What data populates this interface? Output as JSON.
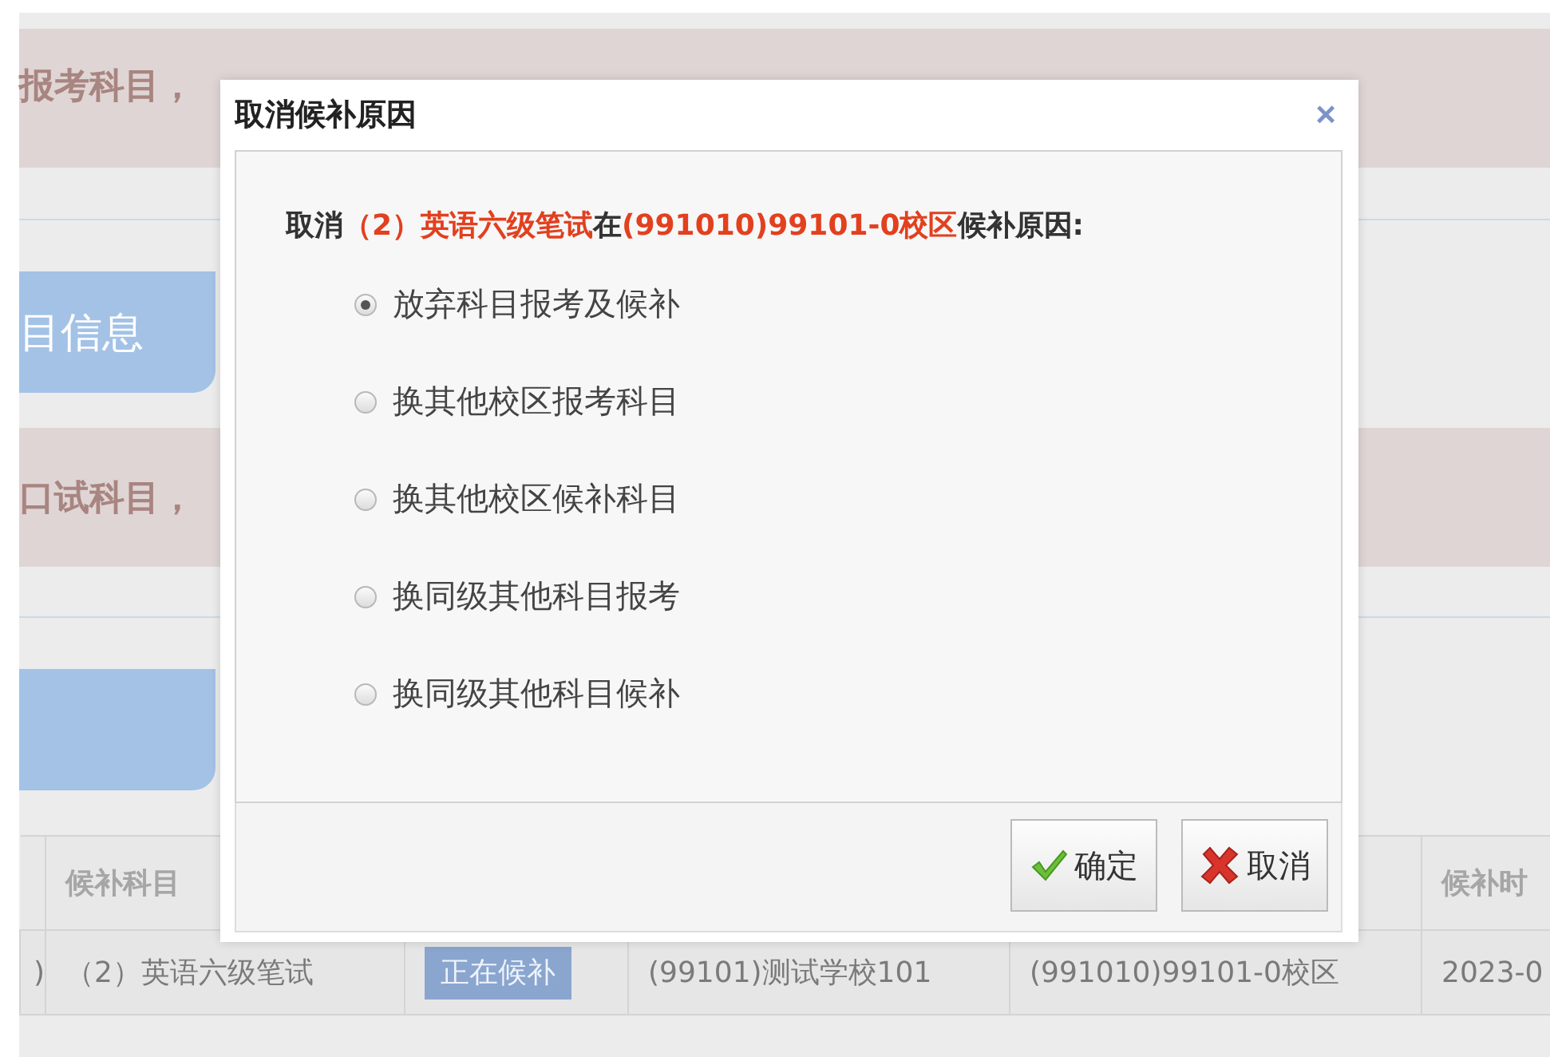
{
  "background": {
    "notice_1": "报考科目，",
    "tab": "目信息",
    "notice_2": "口试科目，",
    "table": {
      "columns": [
        {},
        {
          "label": "候补科目"
        },
        {},
        {},
        {},
        {
          "label": "候补时"
        }
      ],
      "rows": [
        {
          "cells": [
            ")",
            "（2）英语六级笔试",
            "正在候补",
            "(99101)测试学校101",
            "(991010)99101-0校区",
            "2023-0"
          ]
        }
      ]
    }
  },
  "dialog": {
    "title": "取消候补原因",
    "close": "×",
    "message": [
      {
        "text": "取消",
        "highlight": false
      },
      {
        "text": "（2）英语六级笔试",
        "highlight": true
      },
      {
        "text": "在",
        "highlight": false
      },
      {
        "text": "(991010)99101-0校区",
        "highlight": true
      },
      {
        "text": "候补原因:",
        "highlight": false
      }
    ],
    "options": [
      {
        "label": "放弃科目报考及候补",
        "selected": true
      },
      {
        "label": "换其他校区报考科目",
        "selected": false
      },
      {
        "label": "换其他校区候补科目",
        "selected": false
      },
      {
        "label": "换同级其他科目报考",
        "selected": false
      },
      {
        "label": "换同级其他科目候补",
        "selected": false
      }
    ],
    "buttons": [
      {
        "label": "确定",
        "kind": "confirm"
      },
      {
        "label": "取消",
        "kind": "cancel"
      }
    ]
  }
}
